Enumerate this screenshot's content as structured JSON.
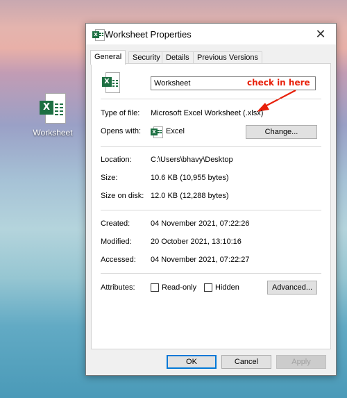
{
  "desktop": {
    "icon_label": "Worksheet",
    "icon_name": "excel-file-icon"
  },
  "dialog": {
    "title": "Worksheet Properties",
    "close_glyph": "✕",
    "tabs": [
      {
        "label": "General",
        "active": true
      },
      {
        "label": "Security"
      },
      {
        "label": "Details"
      },
      {
        "label": "Previous Versions"
      }
    ],
    "file_name": "Worksheet",
    "annotation": "check in here",
    "type_of_file": {
      "label": "Type of file:",
      "value": "Microsoft Excel Worksheet (.xlsx)"
    },
    "opens_with": {
      "label": "Opens with:",
      "value": "Excel",
      "button": "Change..."
    },
    "location": {
      "label": "Location:",
      "value": "C:\\Users\\bhavy\\Desktop"
    },
    "size": {
      "label": "Size:",
      "value": "10.6 KB (10,955 bytes)"
    },
    "size_on_disk": {
      "label": "Size on disk:",
      "value": "12.0 KB (12,288 bytes)"
    },
    "created": {
      "label": "Created:",
      "value": "04 November 2021, 07:22:26"
    },
    "modified": {
      "label": "Modified:",
      "value": "20 October 2021, 13:10:16"
    },
    "accessed": {
      "label": "Accessed:",
      "value": "04 November 2021, 07:22:27"
    },
    "attributes": {
      "label": "Attributes:",
      "read_only": {
        "label": "Read-only",
        "checked": false
      },
      "hidden": {
        "label": "Hidden",
        "checked": false
      },
      "advanced_button": "Advanced..."
    },
    "buttons": {
      "ok": "OK",
      "cancel": "Cancel",
      "apply": "Apply"
    }
  },
  "colors": {
    "excel_green": "#1d6f42",
    "annotation_red": "#e8200a",
    "focus_blue": "#0078d7",
    "dialog_bg": "#f0f0f0"
  },
  "icon_letter": "X"
}
